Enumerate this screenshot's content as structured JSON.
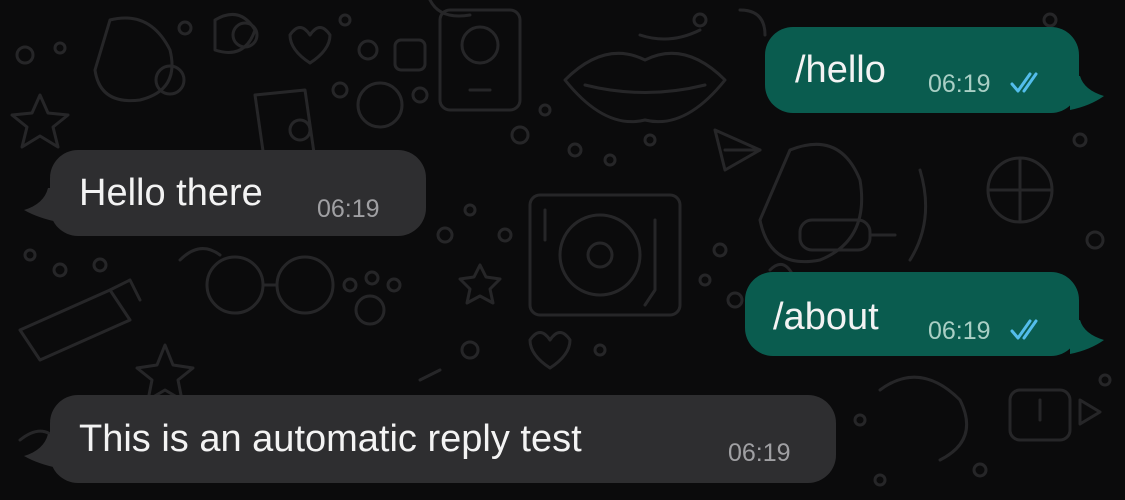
{
  "chat": {
    "messages": [
      {
        "direction": "outgoing",
        "text": "/hello",
        "time": "06:19",
        "status_icon": "double-check-read-icon"
      },
      {
        "direction": "incoming",
        "text": "Hello there",
        "time": "06:19"
      },
      {
        "direction": "outgoing",
        "text": "/about",
        "time": "06:19",
        "status_icon": "double-check-read-icon"
      },
      {
        "direction": "incoming",
        "text": "This is an automatic reply test",
        "time": "06:19"
      }
    ]
  },
  "colors": {
    "background": "#0b0b0c",
    "incoming_bubble": "#2e2e30",
    "outgoing_bubble": "#0a5c4f",
    "read_tick": "#53bdeb"
  }
}
